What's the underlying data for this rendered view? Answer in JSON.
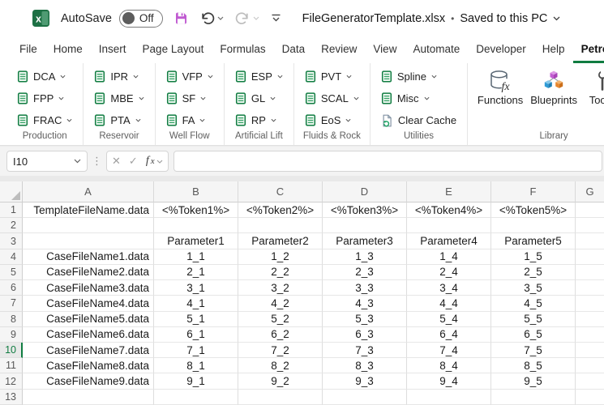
{
  "colors": {
    "accent_green": "#107c41",
    "save_purple": "#c05ad1",
    "cube_purple": "#c25dd1",
    "cube_blue": "#2e9bd6",
    "cube_orange": "#e8872e"
  },
  "title_bar": {
    "autosave_label": "AutoSave",
    "autosave_state": "Off",
    "document_title": "FileGeneratorTemplate.xlsx",
    "separator": "•",
    "save_status": "Saved to this PC"
  },
  "menu_tabs": [
    {
      "label": "File",
      "active": false
    },
    {
      "label": "Home",
      "active": false
    },
    {
      "label": "Insert",
      "active": false
    },
    {
      "label": "Page Layout",
      "active": false
    },
    {
      "label": "Formulas",
      "active": false
    },
    {
      "label": "Data",
      "active": false
    },
    {
      "label": "Review",
      "active": false
    },
    {
      "label": "View",
      "active": false
    },
    {
      "label": "Automate",
      "active": false
    },
    {
      "label": "Developer",
      "active": false
    },
    {
      "label": "Help",
      "active": false
    },
    {
      "label": "Petrol",
      "active": true
    }
  ],
  "ribbon": {
    "small_groups": [
      {
        "name": "Production",
        "buttons": [
          {
            "label": "DCA",
            "menu": true
          },
          {
            "label": "FPP",
            "menu": true
          },
          {
            "label": "FRAC",
            "menu": true
          }
        ]
      },
      {
        "name": "Reservoir",
        "buttons": [
          {
            "label": "IPR",
            "menu": true
          },
          {
            "label": "MBE",
            "menu": true
          },
          {
            "label": "PTA",
            "menu": true
          }
        ]
      },
      {
        "name": "Well Flow",
        "buttons": [
          {
            "label": "VFP",
            "menu": true
          },
          {
            "label": "SF",
            "menu": true
          },
          {
            "label": "FA",
            "menu": true
          }
        ]
      },
      {
        "name": "Artificial Lift",
        "buttons": [
          {
            "label": "ESP",
            "menu": true
          },
          {
            "label": "GL",
            "menu": true
          },
          {
            "label": "RP",
            "menu": true
          }
        ]
      },
      {
        "name": "Fluids & Rock",
        "buttons": [
          {
            "label": "PVT",
            "menu": true
          },
          {
            "label": "SCAL",
            "menu": true
          },
          {
            "label": "EoS",
            "menu": true
          }
        ]
      },
      {
        "name": "Utilities",
        "buttons": [
          {
            "label": "Spline",
            "menu": true
          },
          {
            "label": "Misc",
            "menu": true
          },
          {
            "label": "Clear Cache",
            "menu": false,
            "icon": "refresh-doc"
          }
        ]
      }
    ],
    "library_group": {
      "name": "Library",
      "buttons": [
        {
          "label": "Functions",
          "icon": "functions",
          "menu": false
        },
        {
          "label": "Blueprints",
          "icon": "blueprints",
          "menu": false
        },
        {
          "label": "Toolbox",
          "icon": "toolbox",
          "menu": true
        }
      ]
    },
    "partial_button_label": "P"
  },
  "formula_bar": {
    "name_box": "I10",
    "formula_value": ""
  },
  "grid": {
    "column_headers": [
      "A",
      "B",
      "C",
      "D",
      "E",
      "F",
      "G"
    ],
    "selected_row": 10,
    "rows": [
      {
        "n": "1",
        "cells": [
          "TemplateFileName.data",
          "<%Token1%>",
          "<%Token2%>",
          "<%Token3%>",
          "<%Token4%>",
          "<%Token5%>",
          ""
        ]
      },
      {
        "n": "2",
        "cells": [
          "",
          "",
          "",
          "",
          "",
          "",
          ""
        ]
      },
      {
        "n": "3",
        "cells": [
          "",
          "Parameter1",
          "Parameter2",
          "Parameter3",
          "Parameter4",
          "Parameter5",
          ""
        ]
      },
      {
        "n": "4",
        "cells": [
          "CaseFileName1.data",
          "1_1",
          "1_2",
          "1_3",
          "1_4",
          "1_5",
          ""
        ]
      },
      {
        "n": "5",
        "cells": [
          "CaseFileName2.data",
          "2_1",
          "2_2",
          "2_3",
          "2_4",
          "2_5",
          ""
        ]
      },
      {
        "n": "6",
        "cells": [
          "CaseFileName3.data",
          "3_1",
          "3_2",
          "3_3",
          "3_4",
          "3_5",
          ""
        ]
      },
      {
        "n": "7",
        "cells": [
          "CaseFileName4.data",
          "4_1",
          "4_2",
          "4_3",
          "4_4",
          "4_5",
          ""
        ]
      },
      {
        "n": "8",
        "cells": [
          "CaseFileName5.data",
          "5_1",
          "5_2",
          "5_3",
          "5_4",
          "5_5",
          ""
        ]
      },
      {
        "n": "9",
        "cells": [
          "CaseFileName6.data",
          "6_1",
          "6_2",
          "6_3",
          "6_4",
          "6_5",
          ""
        ]
      },
      {
        "n": "10",
        "cells": [
          "CaseFileName7.data",
          "7_1",
          "7_2",
          "7_3",
          "7_4",
          "7_5",
          ""
        ]
      },
      {
        "n": "11",
        "cells": [
          "CaseFileName8.data",
          "8_1",
          "8_2",
          "8_3",
          "8_4",
          "8_5",
          ""
        ]
      },
      {
        "n": "12",
        "cells": [
          "CaseFileName9.data",
          "9_1",
          "9_2",
          "9_3",
          "9_4",
          "9_5",
          ""
        ]
      },
      {
        "n": "13",
        "cells": [
          "",
          "",
          "",
          "",
          "",
          "",
          ""
        ]
      }
    ]
  }
}
